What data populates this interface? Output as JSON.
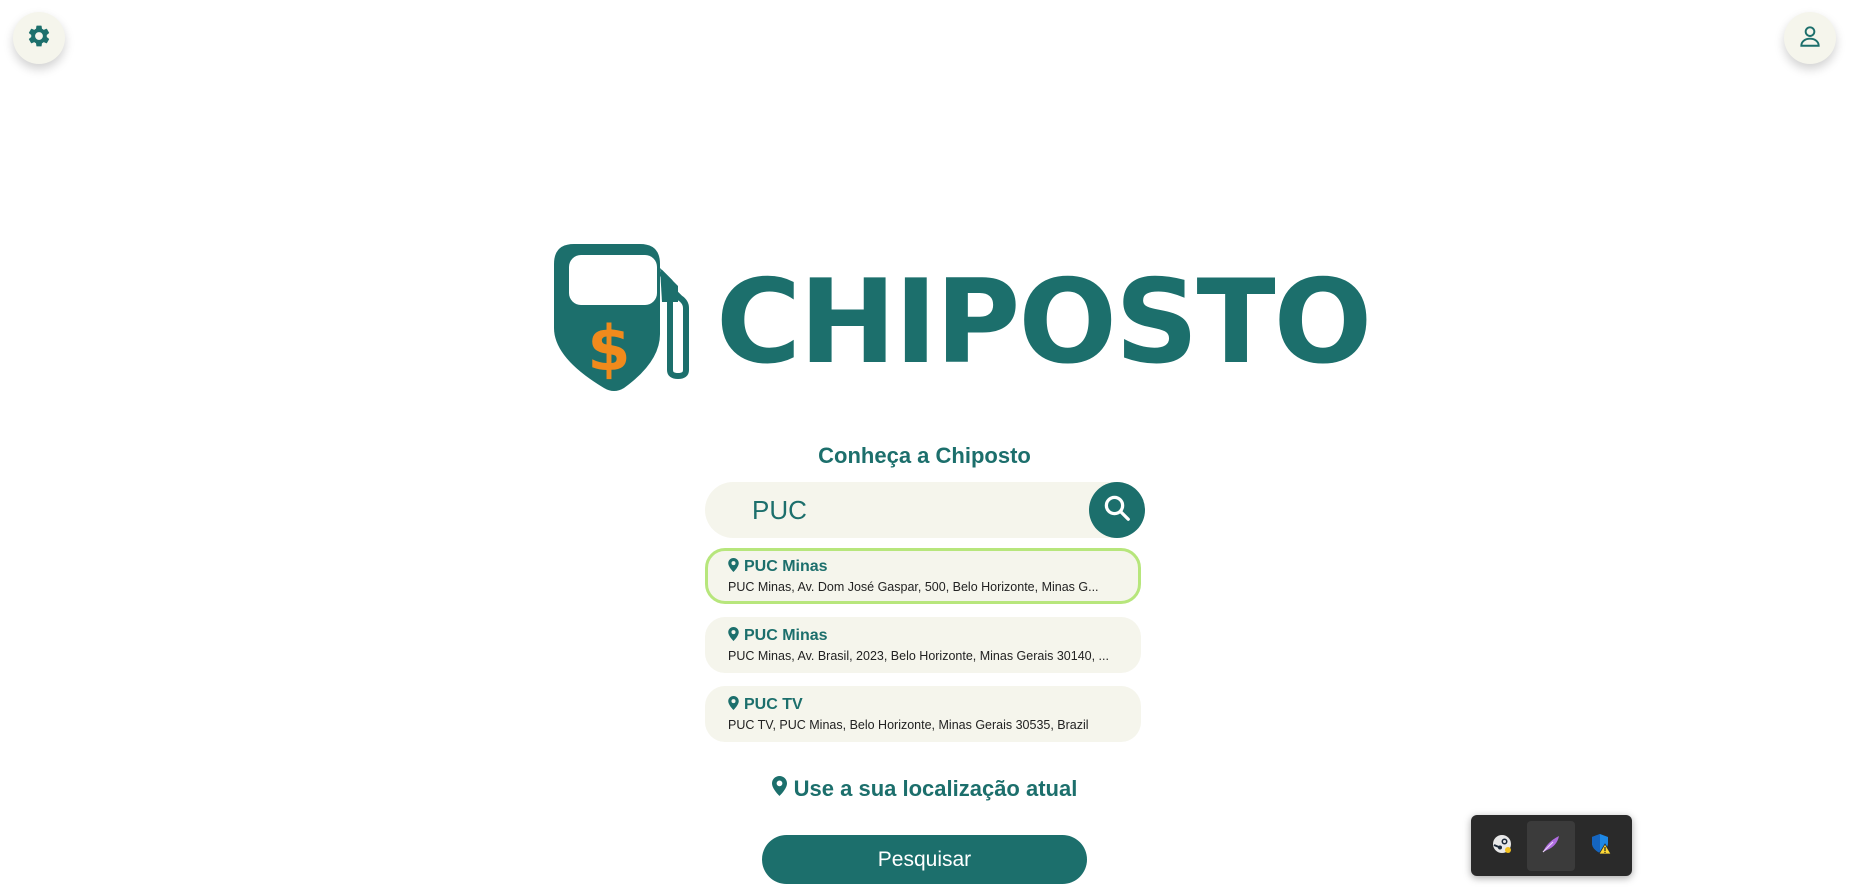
{
  "header": {
    "settings_icon": "gear-icon",
    "profile_icon": "user-icon"
  },
  "brand": {
    "name": "CHIPOSTO",
    "logo_icon": "fuel-pump-dollar-icon",
    "colors": {
      "primary": "#1c6f6c",
      "accent": "#f08a1c",
      "surface": "#f5f5ec",
      "selected_border": "#b7e67c"
    }
  },
  "tagline": "Conheça a Chiposto",
  "search": {
    "value": "PUC",
    "icon": "search-icon"
  },
  "suggestions": [
    {
      "title": "PUC Minas",
      "address": "PUC Minas, Av. Dom José Gaspar, 500, Belo Horizonte, Minas G...",
      "selected": true
    },
    {
      "title": "PUC Minas",
      "address": "PUC Minas, Av. Brasil, 2023, Belo Horizonte, Minas Gerais 30140, ...",
      "selected": false
    },
    {
      "title": "PUC TV",
      "address": "PUC TV, PUC Minas, Belo Horizonte, Minas Gerais 30535, Brazil",
      "selected": false
    }
  ],
  "use_location": {
    "label": "Use a sua localização atual",
    "icon": "map-pin-icon"
  },
  "submit": {
    "label": "Pesquisar"
  },
  "system_tray": {
    "items": [
      "steam-icon",
      "feather-app-icon",
      "windows-security-warning-icon"
    ]
  }
}
